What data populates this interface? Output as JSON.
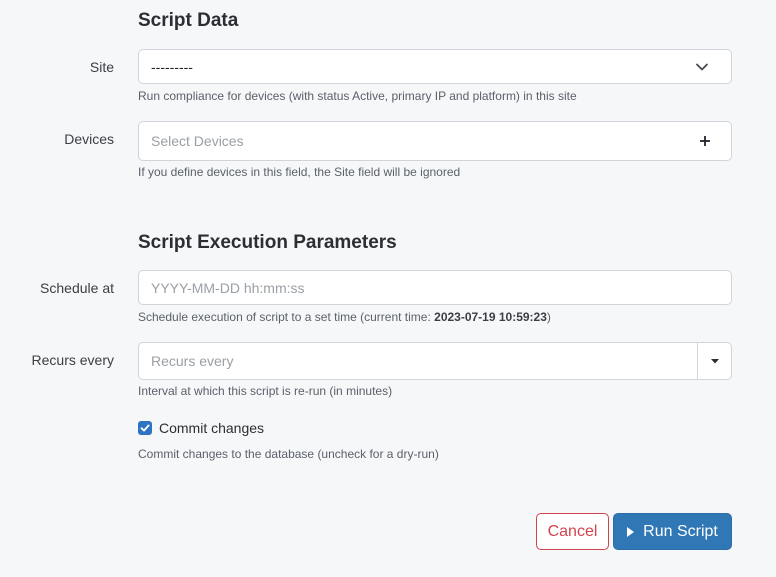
{
  "script_data": {
    "title": "Script Data",
    "site": {
      "label": "Site",
      "value": "---------",
      "help": "Run compliance for devices (with status Active, primary IP and platform) in this site"
    },
    "devices": {
      "label": "Devices",
      "placeholder": "Select Devices",
      "help": "If you define devices in this field, the Site field will be ignored"
    }
  },
  "execution": {
    "title": "Script Execution Parameters",
    "schedule": {
      "label": "Schedule at",
      "placeholder": "YYYY-MM-DD hh:mm:ss",
      "help_prefix": "Schedule execution of script to a set time (current time: ",
      "current_time": "2023-07-19 10:59:23",
      "help_suffix": ")"
    },
    "recurs": {
      "label": "Recurs every",
      "placeholder": "Recurs every",
      "help": "Interval at which this script is re-run (in minutes)"
    },
    "commit": {
      "label": "Commit changes",
      "checked": true,
      "help": "Commit changes to the database (uncheck for a dry-run)"
    }
  },
  "actions": {
    "cancel_label": "Cancel",
    "run_label": "Run Script"
  },
  "colors": {
    "background": "#f6f7f9",
    "accent": "#3077b6",
    "danger": "#d1434f"
  }
}
